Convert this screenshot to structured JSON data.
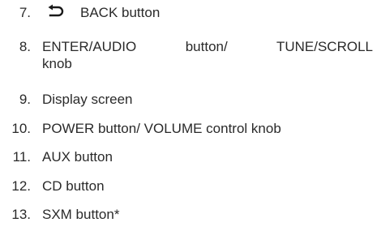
{
  "items": [
    {
      "number": "7.",
      "label": "BACK button",
      "icon": "back-arrow-icon"
    },
    {
      "number": "8.",
      "line1": "ENTER/AUDIO   button/   TUNE/SCROLL",
      "line2": "knob"
    },
    {
      "number": "9.",
      "label": "Display screen"
    },
    {
      "number": "10.",
      "label": "POWER button/ VOLUME control knob"
    },
    {
      "number": "11.",
      "label": "AUX button"
    },
    {
      "number": "12.",
      "label": "CD button"
    },
    {
      "number": "13.",
      "label": "SXM button*"
    }
  ]
}
